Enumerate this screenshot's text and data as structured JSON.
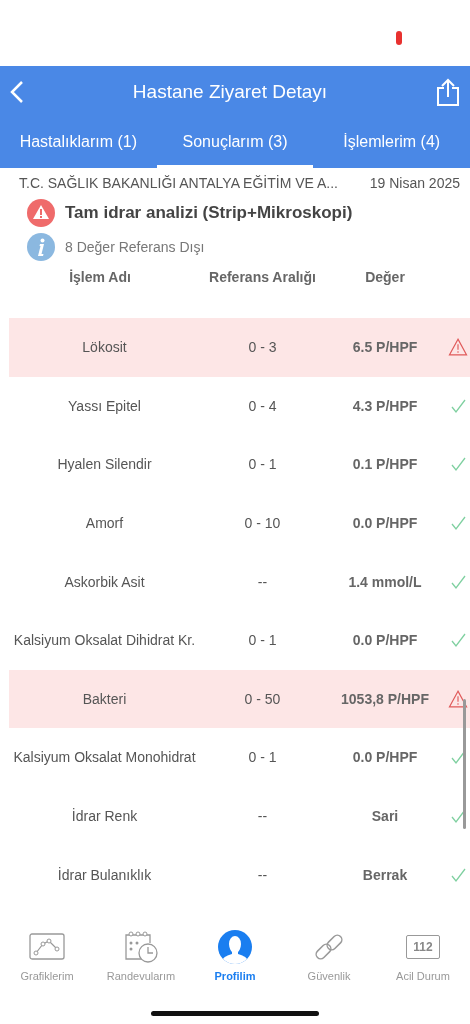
{
  "header": {
    "title": "Hastane Ziyaret Detayı"
  },
  "tabs": [
    {
      "label": "Hastalıklarım (1)",
      "selected": false
    },
    {
      "label": "Sonuçlarım (3)",
      "selected": true
    },
    {
      "label": "İşlemlerim (4)",
      "selected": false
    }
  ],
  "visit": {
    "hospital": "T.C. SAĞLIK BAKANLIĞI ANTALYA EĞİTİM VE A...",
    "date": "19 Nisan 2025"
  },
  "test": {
    "name": "Tam idrar analizi (Strip+Mikroskopi)",
    "out_of_range": true,
    "note": "8 Değer Referans Dışı"
  },
  "table": {
    "columns": [
      "İşlem Adı",
      "Referans Aralığı",
      "Değer"
    ],
    "rows": [
      {
        "name": "Lökosit",
        "reference": "0 - 3",
        "value": "6.5 P/HPF",
        "out_of_range": true
      },
      {
        "name": "Yassı Epitel",
        "reference": "0 - 4",
        "value": "4.3 P/HPF",
        "out_of_range": false
      },
      {
        "name": "Hyalen Silendir",
        "reference": "0 - 1",
        "value": "0.1 P/HPF",
        "out_of_range": false
      },
      {
        "name": "Amorf",
        "reference": "0 - 10",
        "value": "0.0 P/HPF",
        "out_of_range": false
      },
      {
        "name": "Askorbik Asit",
        "reference": "--",
        "value": "1.4 mmol/L",
        "out_of_range": false
      },
      {
        "name": "Kalsiyum Oksalat Dihidrat Kr.",
        "reference": "0 - 1",
        "value": "0.0 P/HPF",
        "out_of_range": false
      },
      {
        "name": "Bakteri",
        "reference": "0 - 50",
        "value": "1053,8 P/HPF",
        "out_of_range": true
      },
      {
        "name": "Kalsiyum Oksalat Monohidrat",
        "reference": "0 - 1",
        "value": "0.0 P/HPF",
        "out_of_range": false
      },
      {
        "name": "İdrar Renk",
        "reference": "--",
        "value": "Sari",
        "out_of_range": false
      },
      {
        "name": "İdrar Bulanıklık",
        "reference": "--",
        "value": "Berrak",
        "out_of_range": false
      }
    ]
  },
  "tab_bar": [
    {
      "label": "Grafiklerim",
      "selected": false
    },
    {
      "label": "Randevularım",
      "selected": false
    },
    {
      "label": "Profilim",
      "selected": true
    },
    {
      "label": "Güvenlik",
      "selected": false
    },
    {
      "label": "Acil Durum",
      "icon_text": "112",
      "selected": false
    }
  ]
}
